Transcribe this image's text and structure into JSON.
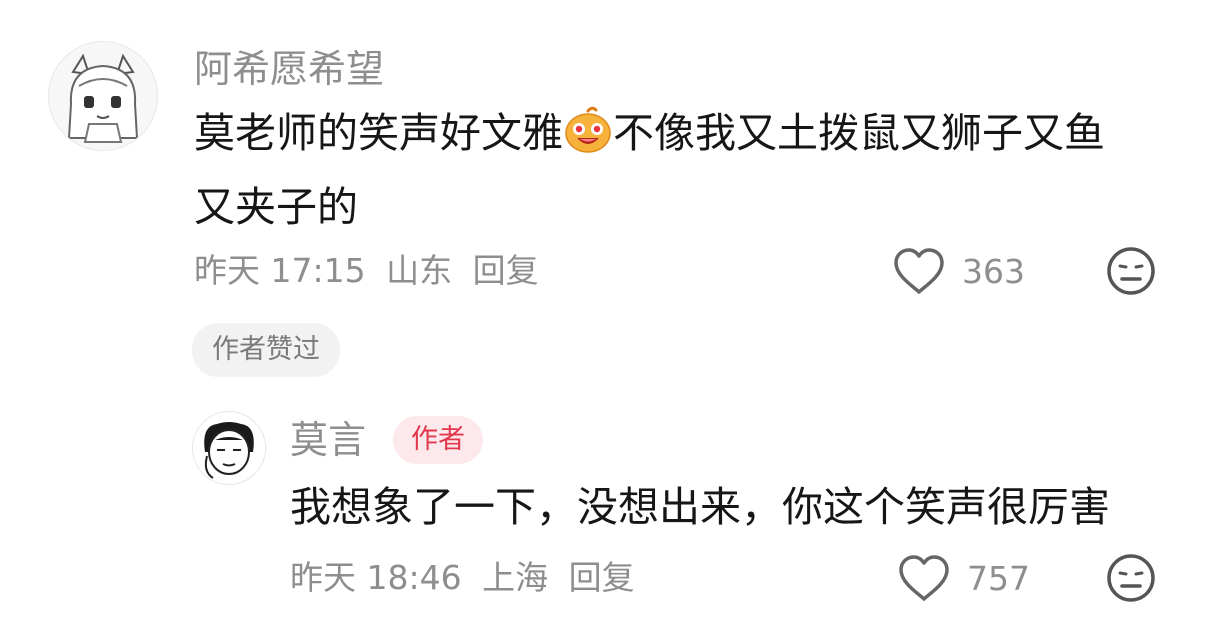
{
  "comment": {
    "username": "阿希愿希望",
    "text_line1": "莫老师的笑声好文雅",
    "text_line1b": "不像我又土拨鼠又狮子又鱼",
    "text_line2": "又夹子的",
    "time": "昨天 17:15",
    "location": "山东",
    "reply_label": "回复",
    "likes": "363",
    "badge": "作者赞过",
    "icons": {
      "like": "heart-outline-icon",
      "dislike": "meh-face-icon",
      "emoji": "grinning-blob-emoji"
    }
  },
  "reply": {
    "username": "莫言",
    "author_tag": "作者",
    "text": "我想象了一下，没想出来，你这个笑声很厉害",
    "time": "昨天 18:46",
    "location": "上海",
    "reply_label": "回复",
    "likes": "757",
    "icons": {
      "like": "heart-outline-icon",
      "dislike": "meh-face-icon"
    }
  },
  "colors": {
    "secondary_text": "#8e8e8e",
    "author_tag_bg": "#fde9ec",
    "author_tag_text": "#e2384d",
    "badge_bg": "#f2f2f2"
  }
}
